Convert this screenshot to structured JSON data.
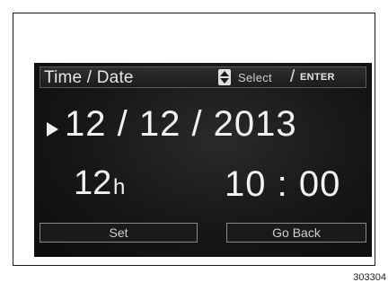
{
  "header": {
    "title": "Time / Date",
    "select_label": "Select",
    "separator": "/",
    "enter_label": "ENTER",
    "arrows_icon": "up-down-arrows-icon"
  },
  "date_row": {
    "indicator_icon": "selection-arrow-icon",
    "value": "12 / 12 / 2013"
  },
  "time_row": {
    "hour_mode_value": "12",
    "hour_mode_unit": "h",
    "value": "10 : 00"
  },
  "buttons": {
    "set_label": "Set",
    "back_label": "Go Back"
  },
  "figure_number": "303304"
}
